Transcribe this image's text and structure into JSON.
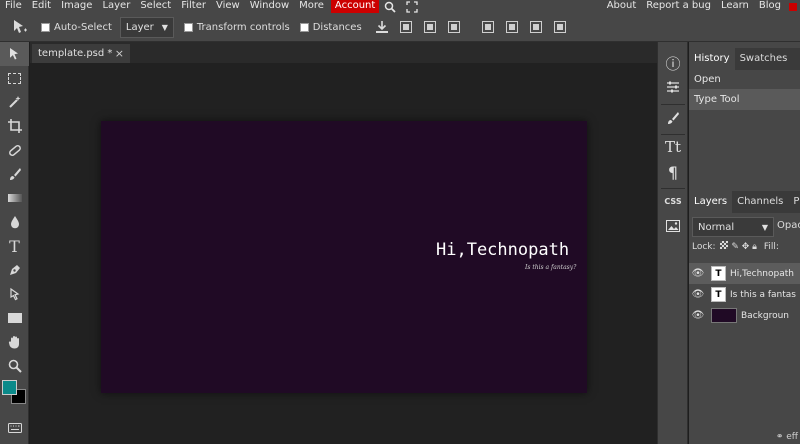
{
  "menu": {
    "items": [
      "File",
      "Edit",
      "Image",
      "Layer",
      "Select",
      "Filter",
      "View",
      "Window",
      "More"
    ],
    "account": "Account",
    "right_links": [
      "About",
      "Report a bug",
      "Learn",
      "Blog"
    ]
  },
  "options": {
    "auto_select_label": "Auto-Select",
    "layer_select_value": "Layer",
    "transform_label": "Transform controls",
    "distances_label": "Distances"
  },
  "document": {
    "tab_title": "template.psd *",
    "close_symbol": "×",
    "canvas_title": "Hi,Technopath",
    "canvas_subtitle": "Is this a fantasy?",
    "canvas_color": "#200a25"
  },
  "iconstrip": {
    "info": "ⓘ",
    "text_small": "Tt",
    "paragraph": "¶",
    "css": "CSS"
  },
  "history_panel": {
    "tabs": [
      "History",
      "Swatches"
    ],
    "rows": [
      "Open",
      "Type Tool"
    ]
  },
  "layers_panel": {
    "tabs": [
      "Layers",
      "Channels",
      "P"
    ],
    "blend_mode": "Normal",
    "opacity_label": "Opac",
    "lock_label": "Lock:",
    "fill_label": "Fill:",
    "layers": [
      {
        "name": "Hi,Technopath",
        "thumb": "T"
      },
      {
        "name": "Is this a fantas",
        "thumb": "T"
      },
      {
        "name": "Backgroun",
        "thumb": ""
      }
    ],
    "footer": "eff"
  },
  "colors": {
    "foreground": "#0b8a8a",
    "background": "#000000",
    "accent": "#cc0000"
  }
}
